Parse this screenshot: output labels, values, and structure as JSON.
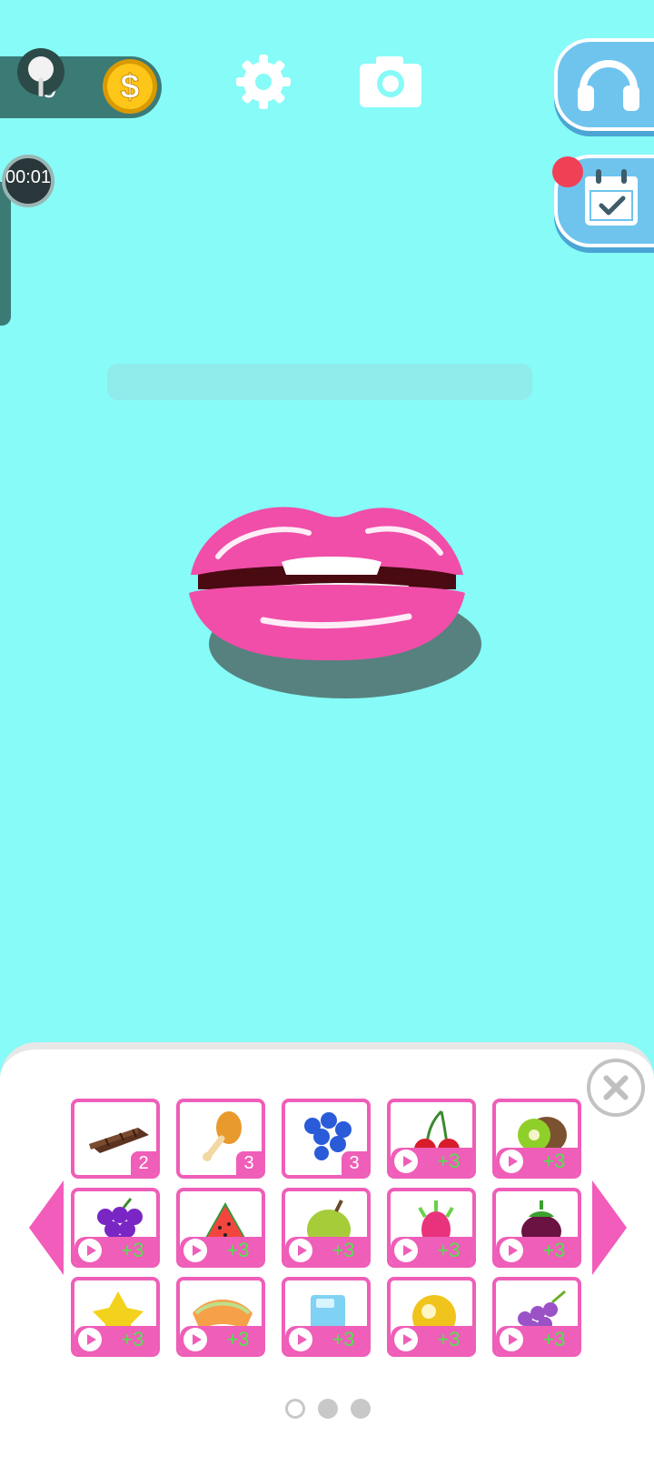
{
  "hud": {
    "coin_count": "0",
    "timer": "00:01",
    "icons": {
      "pin": "pin-icon",
      "coin": "dollar-coin-icon",
      "settings": "gear-icon",
      "screenshot": "camera-icon",
      "support": "headset-icon",
      "daily": "calendar-check-icon"
    }
  },
  "progress": {
    "value": 0
  },
  "palette": {
    "background": "#86fbf7",
    "accent_pink": "#ef5eb8",
    "bonus_green": "#4fe44f",
    "button_blue": "#6fc4ee",
    "notification_red": "#ef4056"
  },
  "food_panel": {
    "items": [
      {
        "icon": "chocolate-bar-icon",
        "count": "2"
      },
      {
        "icon": "chicken-leg-icon",
        "count": "3"
      },
      {
        "icon": "blueberries-icon",
        "count": "3"
      },
      {
        "icon": "cherries-icon",
        "bonus": "+3"
      },
      {
        "icon": "kiwi-icon",
        "bonus": "+3"
      },
      {
        "icon": "grapes-icon",
        "bonus": "+3"
      },
      {
        "icon": "watermelon-icon",
        "bonus": "+3"
      },
      {
        "icon": "durian-icon",
        "bonus": "+3"
      },
      {
        "icon": "dragon-fruit-icon",
        "bonus": "+3"
      },
      {
        "icon": "mangosteen-icon",
        "bonus": "+3"
      },
      {
        "icon": "star-fruit-icon",
        "bonus": "+3"
      },
      {
        "icon": "cantaloupe-icon",
        "bonus": "+3"
      },
      {
        "icon": "ice-cube-icon",
        "bonus": "+3"
      },
      {
        "icon": "grapefruit-icon",
        "bonus": "+3"
      },
      {
        "icon": "purple-grapes-icon",
        "bonus": "+3"
      }
    ],
    "pages": {
      "total": 3,
      "current": 1
    }
  }
}
